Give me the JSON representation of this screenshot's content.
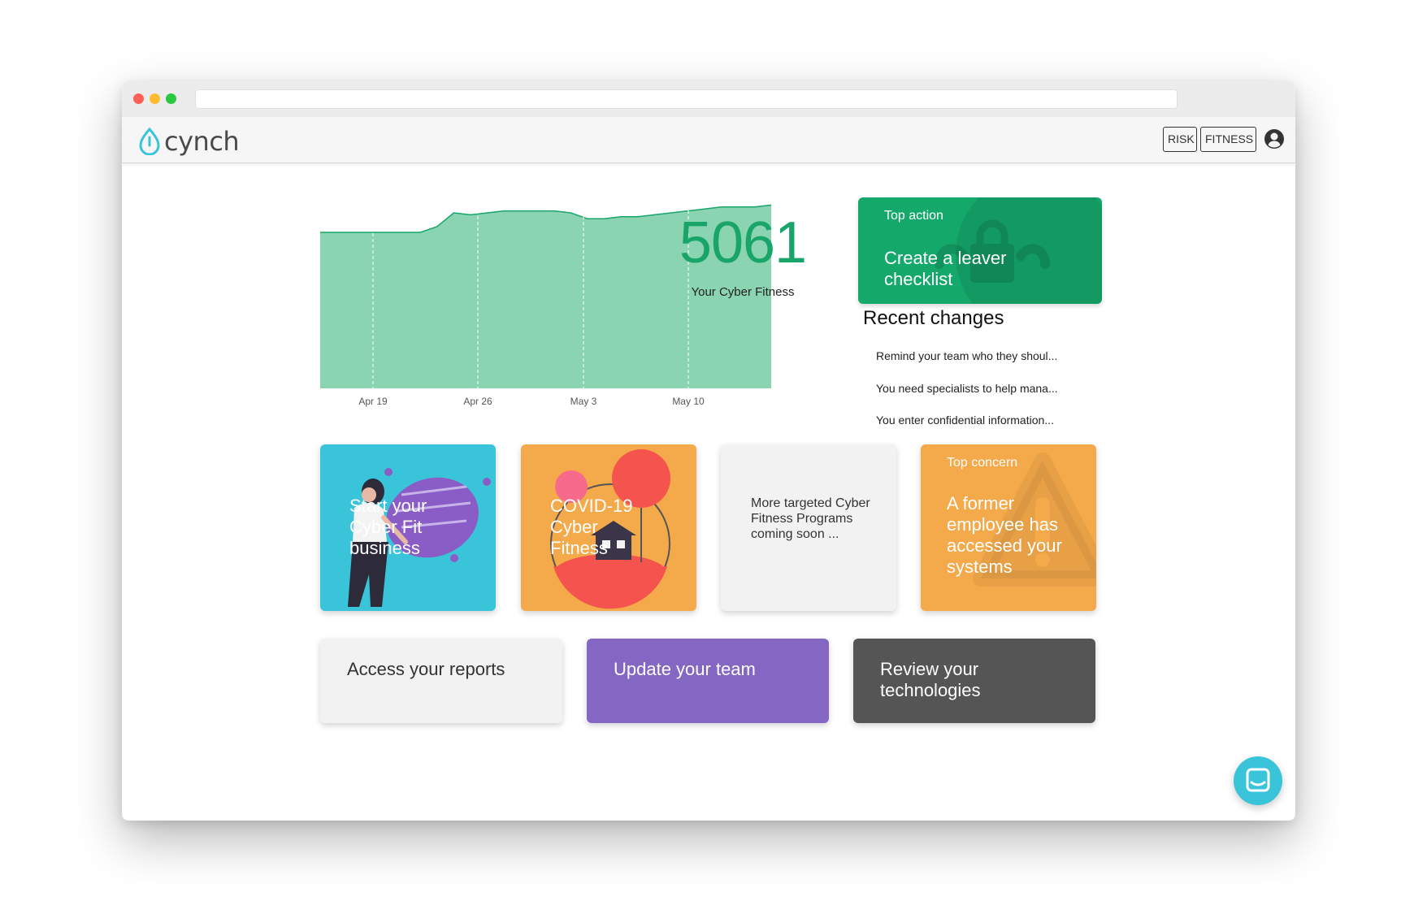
{
  "app": {
    "name": "cynch"
  },
  "nav": {
    "risk_label": "RISK",
    "fitness_label": "FITNESS"
  },
  "chart_data": {
    "type": "area",
    "x_ticks": [
      "Apr 19",
      "Apr 26",
      "May 3",
      "May 10"
    ],
    "y_range_note": "relative fitness score, no y axis shown",
    "color": "#8ad4b2",
    "line_color": "#19a56a",
    "values": [
      80,
      80,
      80,
      80,
      80,
      80,
      80,
      83,
      90,
      89,
      90,
      91,
      91,
      91,
      91,
      90,
      87,
      87,
      88,
      88,
      89,
      90,
      91,
      92,
      93,
      93,
      93,
      94
    ]
  },
  "score": {
    "value": "5061",
    "label": "Your Cyber Fitness"
  },
  "top_action": {
    "kicker": "Top action",
    "title": "Create a leaver checklist"
  },
  "recent": {
    "title": "Recent changes",
    "items": [
      "Remind your team who they shoul...",
      "You need specialists to help mana...",
      "You enter confidential information..."
    ]
  },
  "tiles": [
    {
      "label": "Start your Cyber Fit business",
      "color": "#3ac4da"
    },
    {
      "label": "COVID-19 Cyber Fitness",
      "color": "#f4a94a"
    },
    {
      "label": "More targeted Cyber Fitness Programs coming soon ...",
      "color": "#f2f2f2"
    },
    {
      "kicker": "Top concern",
      "label": "A former employee has accessed your systems",
      "color": "#f4a94a"
    }
  ],
  "actions": {
    "reports": "Access your reports",
    "team": "Update your team",
    "tech": "Review your technologies"
  },
  "icons": {
    "user": "user-icon",
    "chat": "chat-icon",
    "lock": "lock-icon",
    "warning": "warning-icon"
  }
}
